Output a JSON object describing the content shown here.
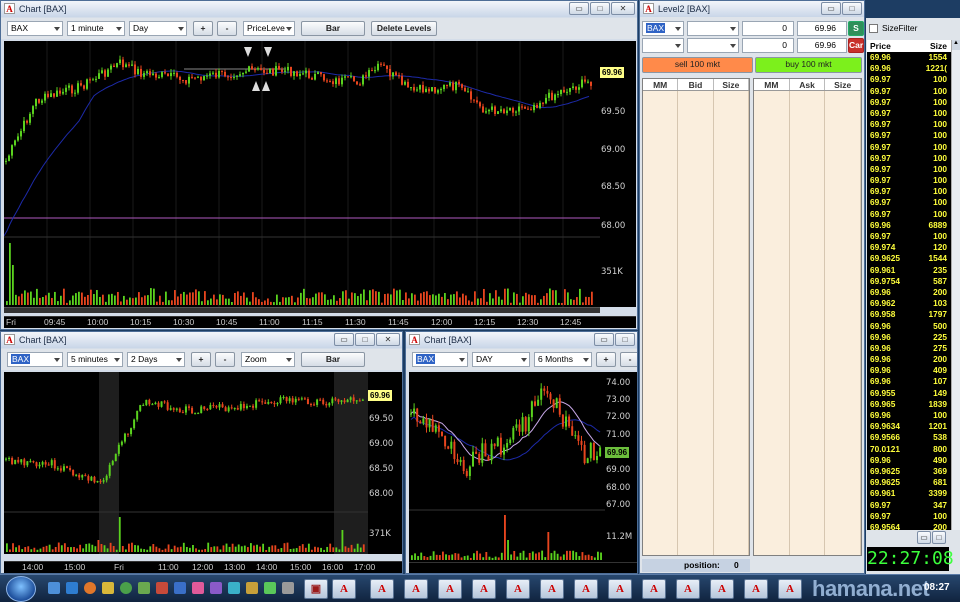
{
  "chart_main": {
    "title": "Chart [BAX]",
    "symbol": "BAX",
    "interval": "1 minute",
    "range": "Day",
    "study": "PriceLeve",
    "plus_label": "+",
    "minus_label": "-",
    "bar_label": "Bar",
    "delete_levels_label": "Delete Levels",
    "price_ticks": [
      "69.50",
      "69.00",
      "68.50",
      "68.00"
    ],
    "current_price": "69.96",
    "volume_label": "351K",
    "time_ticks": [
      "Fri",
      "09:45",
      "10:00",
      "10:15",
      "10:30",
      "10:45",
      "11:00",
      "11:15",
      "11:30",
      "11:45",
      "12:00",
      "12:15",
      "12:30",
      "12:45"
    ]
  },
  "chart_5min": {
    "title": "Chart [BAX]",
    "symbol": "BAX",
    "interval": "5 minutes",
    "range": "2 Days",
    "study": "Zoom",
    "plus_label": "+",
    "minus_label": "-",
    "bar_label": "Bar",
    "price_ticks": [
      "69.50",
      "69.00",
      "68.50",
      "68.00"
    ],
    "current_price": "69.96",
    "volume_label": "371K",
    "time_ticks": [
      "14:00",
      "15:00",
      "Fri",
      "11:00",
      "12:00",
      "13:00",
      "14:00",
      "15:00",
      "16:00",
      "17:00"
    ]
  },
  "chart_day": {
    "title": "Chart [BAX]",
    "symbol": "BAX",
    "interval": "DAY",
    "range": "6 Months",
    "plus_label": "+",
    "minus_label": "-",
    "price_ticks": [
      "74.00",
      "73.00",
      "72.00",
      "71.00",
      "70.00",
      "69.00",
      "68.00",
      "67.00"
    ],
    "current_price": "69.96",
    "volume_label": "11.2M"
  },
  "level2": {
    "title": "Level2 [BAX]",
    "symbol": "BAX",
    "qty1": "0",
    "price1": "69.96",
    "qty2": "0",
    "price2": "69.96",
    "send_label": "S",
    "cancel_label": "Car",
    "sell_label": "sell 100 mkt",
    "buy_label": "buy 100 mkt",
    "bid_headers": [
      "MM",
      "Bid",
      "Size"
    ],
    "ask_headers": [
      "MM",
      "Ask",
      "Size"
    ],
    "position_label": "position:",
    "position_value": "0"
  },
  "time_sales": {
    "size_filter_label": "SizeFilter",
    "headers": [
      "Price",
      "Size"
    ],
    "rows": [
      [
        "69.96",
        "1554"
      ],
      [
        "69.96",
        "1221("
      ],
      [
        "69.97",
        "100"
      ],
      [
        "69.97",
        "100"
      ],
      [
        "69.97",
        "100"
      ],
      [
        "69.97",
        "100"
      ],
      [
        "69.97",
        "100"
      ],
      [
        "69.97",
        "100"
      ],
      [
        "69.97",
        "100"
      ],
      [
        "69.97",
        "100"
      ],
      [
        "69.97",
        "100"
      ],
      [
        "69.97",
        "100"
      ],
      [
        "69.97",
        "100"
      ],
      [
        "69.97",
        "100"
      ],
      [
        "69.97",
        "100"
      ],
      [
        "69.96",
        "6889"
      ],
      [
        "69.97",
        "100"
      ],
      [
        "69.974",
        "120"
      ],
      [
        "69.9625",
        "1544"
      ],
      [
        "69.961",
        "235"
      ],
      [
        "69.9754",
        "587"
      ],
      [
        "69.96",
        "200"
      ],
      [
        "69.962",
        "103"
      ],
      [
        "69.958",
        "1797"
      ],
      [
        "69.96",
        "500"
      ],
      [
        "69.96",
        "225"
      ],
      [
        "69.96",
        "275"
      ],
      [
        "69.96",
        "200"
      ],
      [
        "69.96",
        "409"
      ],
      [
        "69.96",
        "107"
      ],
      [
        "69.955",
        "149"
      ],
      [
        "69.965",
        "1839"
      ],
      [
        "69.96",
        "100"
      ],
      [
        "69.9634",
        "1201"
      ],
      [
        "69.9566",
        "538"
      ],
      [
        "70.0121",
        "800"
      ],
      [
        "69.96",
        "490"
      ],
      [
        "69.9625",
        "369"
      ],
      [
        "69.9625",
        "681"
      ],
      [
        "69.961",
        "3399"
      ],
      [
        "69.97",
        "347"
      ],
      [
        "69.97",
        "100"
      ],
      [
        "69.9564",
        "200"
      ]
    ],
    "clock": "22:27:08"
  },
  "taskbar": {
    "tray_time": "08:27",
    "watermark": "hamana.net"
  },
  "colors": {
    "up_bar": "#5ad21e",
    "down_bar": "#e8451e",
    "ma_line": "#1d2aa8",
    "ma2_line": "#c8a8e8",
    "level_line": "#b05abf",
    "sell_button": "#ff8a4a",
    "buy_button": "#7cf01c",
    "tape_text": "#ffff3c",
    "clock_text": "#3cff3c"
  }
}
